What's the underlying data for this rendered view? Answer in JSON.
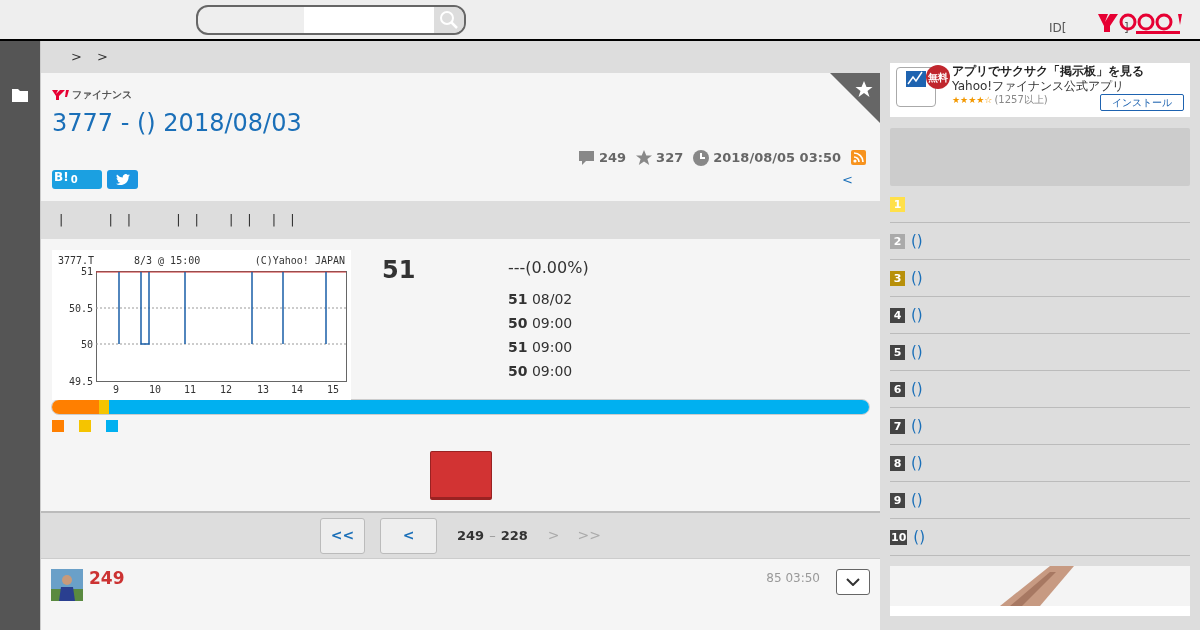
{
  "header": {
    "login_text": "ID[",
    "login_close": "]"
  },
  "breadcrumb": [
    ">",
    ">"
  ],
  "title": {
    "brand": "ファイナンス",
    "heading": "3777 - () 2018/08/03"
  },
  "meta": {
    "comments": "249",
    "stars": "327",
    "datetime": "2018/08/05 03:50"
  },
  "share": {
    "hatena_label": "B!",
    "hatena_count": "0",
    "back_link": "<"
  },
  "tabs": [
    {
      "label": "|"
    },
    {
      "label": "|"
    },
    {
      "label": "|"
    },
    {
      "label": "|"
    },
    {
      "label": "|"
    },
    {
      "label": "|"
    },
    {
      "label": "|"
    },
    {
      "label": "|"
    },
    {
      "label": "|"
    }
  ],
  "chart": {
    "symbol": "3777.T",
    "time": "8/3 @ 15:00",
    "credit": "(C)Yahoo! JAPAN",
    "y_labels": [
      "51",
      "50.5",
      "50",
      "49.5"
    ],
    "x_labels": [
      "9",
      "10",
      "11",
      "12",
      "13",
      "14",
      "15"
    ]
  },
  "quote": {
    "price": "51",
    "change": "---(0.00%)",
    "rows": [
      "**51** 08/02",
      "**50** 09:00",
      "**51** 09:00",
      "**50** 09:00"
    ]
  },
  "sentiment": [
    {
      "color": "#ff7f00",
      "level": 0.057
    },
    {
      "color": "#f5c400",
      "level": 0.013
    },
    {
      "color": "#00b0f0",
      "level": 0.93
    }
  ],
  "pager": {
    "first": "<<",
    "prev": "<",
    "range_start": "249",
    "dash": "–",
    "range_end": "228",
    "next": ">",
    "last": ">>"
  },
  "post": {
    "number": "249",
    "time": "85 03:50"
  },
  "ad": {
    "badge": "無料",
    "headline": "アプリでサクサク「掲示板」を見る",
    "app": "Yahoo!ファイナンス公式アプリ",
    "stars": 4,
    "rating": "(1257以上)",
    "install": "インストール"
  },
  "ranking": [
    {
      "rank": "1",
      "color": "#ffe04a"
    },
    {
      "rank": "2",
      "color": "#aaaaaa",
      "text": "()"
    },
    {
      "rank": "3",
      "color": "#b8900a",
      "text": "()"
    },
    {
      "rank": "4",
      "color": "#444444",
      "text": "()"
    },
    {
      "rank": "5",
      "color": "#444444",
      "text": "()"
    },
    {
      "rank": "6",
      "color": "#444444",
      "text": "()"
    },
    {
      "rank": "7",
      "color": "#444444",
      "text": "()"
    },
    {
      "rank": "8",
      "color": "#444444",
      "text": "()"
    },
    {
      "rank": "9",
      "color": "#444444",
      "text": "()"
    },
    {
      "rank": "10",
      "color": "#444444",
      "text": "()"
    }
  ]
}
